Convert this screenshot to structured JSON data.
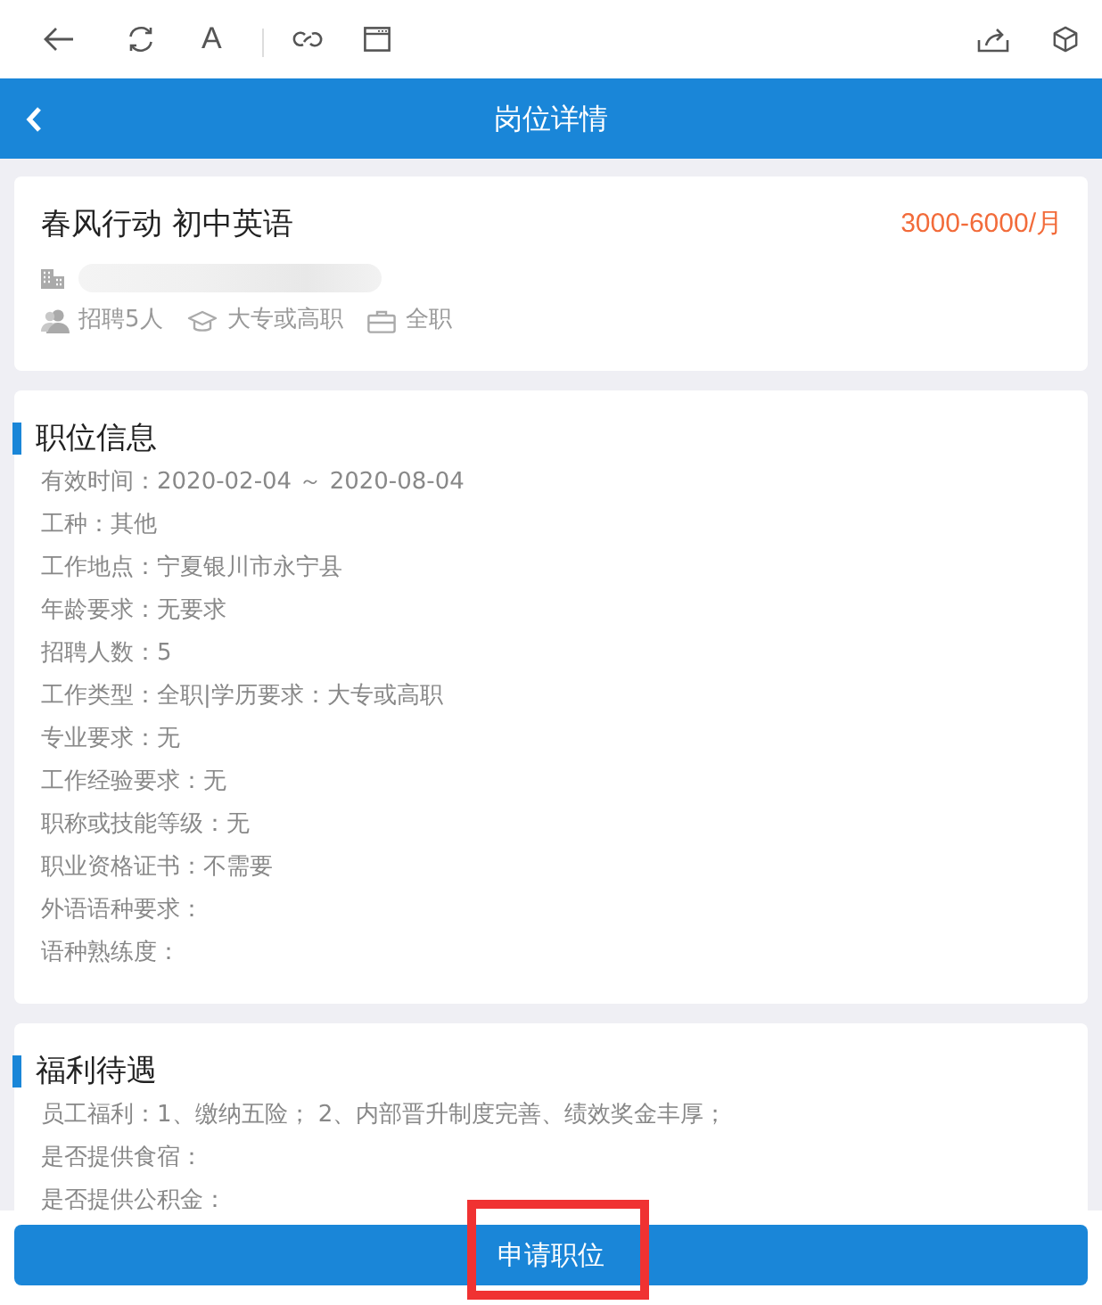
{
  "toolbar": {
    "text_size_label": "A"
  },
  "header": {
    "title": "岗位详情"
  },
  "job": {
    "title": "春风行动 初中英语",
    "salary": "3000-6000/月",
    "tags": [
      {
        "kind": "people",
        "text": "招聘5人"
      },
      {
        "kind": "education",
        "text": "大专或高职"
      },
      {
        "kind": "worktype",
        "text": "全职"
      }
    ]
  },
  "sections": [
    {
      "title": "职位信息",
      "lines": [
        "有效时间：2020-02-04 ～ 2020-08-04",
        "工种：其他",
        "工作地点：宁夏银川市永宁县",
        "年龄要求：无要求",
        "招聘人数：5",
        "工作类型：全职|学历要求：大专或高职",
        "专业要求：无",
        "工作经验要求：无",
        "职称或技能等级：无",
        "职业资格证书：不需要",
        "外语语种要求：",
        "语种熟练度："
      ]
    },
    {
      "title": "福利待遇",
      "lines": [
        "员工福利：1、缴纳五险； 2、内部晋升制度完善、绩效奖金丰厚；",
        "是否提供食宿：",
        "是否提供公积金："
      ]
    }
  ],
  "apply_button": {
    "label": "申请职位",
    "highlighted": true
  }
}
